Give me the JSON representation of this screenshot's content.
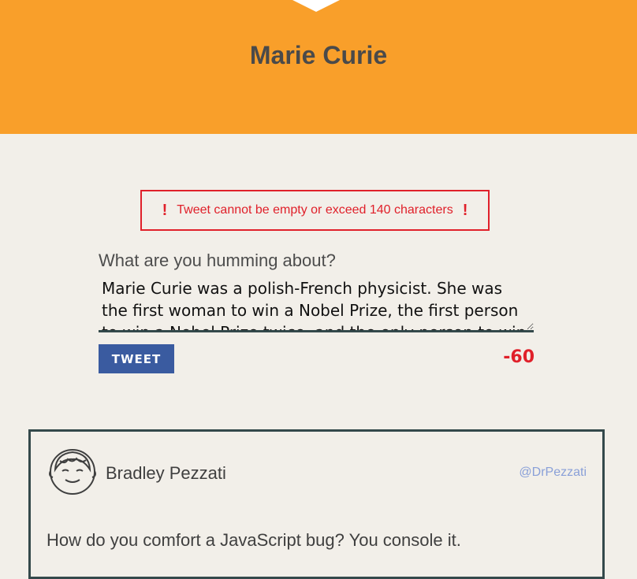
{
  "header": {
    "title": "Marie Curie",
    "background_color": "#f99f2a"
  },
  "error": {
    "icon": "exclamation-icon",
    "message": "Tweet cannot be empty or exceed 140 characters",
    "color": "#e0202a"
  },
  "composer": {
    "label": "What are you humming about?",
    "value": "Marie Curie was a polish-French physicist. She was the first woman to win a Nobel Prize, the first person to win a Nobel Prize twice, and the only person to win a Nobel Prize in two different sciences. Amazing!",
    "button_label": "TWEET",
    "button_color": "#3a5ba0",
    "char_count": "-60"
  },
  "tweets": [
    {
      "avatar_icon": "cartoon-face-icon",
      "name": "Bradley Pezzati",
      "handle": "@DrPezzati",
      "text": "How do you comfort a JavaScript bug? You console it."
    }
  ]
}
